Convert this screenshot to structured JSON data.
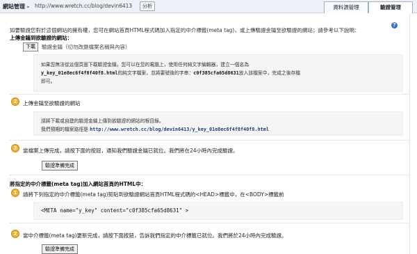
{
  "header": {
    "title": "網站管理",
    "separator": " - ",
    "url": "http://www.wretch.cc/blog/devin6413",
    "analyze_label": "分析",
    "tabs": [
      {
        "label": "資料源管理"
      },
      {
        "label": "驗證管理"
      }
    ]
  },
  "intro": "如要驗證您對於這個網站的擁有權，您可在網站首頁HTML程式碼加入指定的中介標籤(meta tag)，或上傳驗證金鑰至欲驗證的網站；請參考以下說明：",
  "section1": {
    "heading": "上傳金鑰到欲驗證的網站：",
    "download_label": "下載",
    "download_desc": "驗證金鑰（切勿改變檔案名稱與內容）",
    "box_line1": "如果您無法從這個頁面下載驗證金鑰，您可以在您的電腦上，使用任何純文字編輯器，建立一個名為",
    "box_line2_file": "y_key_01e8ec6f4f8f40f8.html",
    "box_line2_mid": "的純文字檔案，並將要號後的字串：",
    "box_line2_key": "c0f385cfa65d8631",
    "box_line2_end": "放入該檔案中，完成之後存檔",
    "box_line3": "即可。",
    "step2_text": "上傳金鑰至欲驗證的網站",
    "box2_line1": "請將下載或自建的驗證金鑰上傳到欲驗證的網站的根目錄。",
    "box2_line2_prefix": "我們預期的檔案路徑是",
    "box2_line2_url": "http://www.wretch.cc/blog/devin6413/y_key_01e8ec6f4f8f40f8.html",
    "step3_text": "當檔案上傳完成，請按下面的按鈕，通知我們驗證金鑰已就位。我們將在24小時內完成驗證。",
    "ready_button": "驗證準備完成"
  },
  "section2": {
    "heading": "將指定的中介標籤(meta tag)加入網站首頁的HTML中：",
    "step1_text": "請將下列指定的中介標籤(meta tag)剪貼到欲驗證網站首頁HTML程式碼的<HEAD>標籤中，在<BODY>標籤前",
    "meta_code": "<META name=\"y_key\" content=\"c0f385cfa65d8631\" >",
    "step2_text": "當中介標籤(meta tag)更新完成，請按下面按鈕，告訴我們指定的中介標籤已就位。我們將於24小時內完成驗證。",
    "ready_button": "驗證準備完成"
  },
  "step_numbers": [
    "1",
    "2",
    "3"
  ],
  "colors": {
    "step_badge": "#f2b232",
    "help_icon": "#3b74c6",
    "topbar": "#eef2f8",
    "codebox": "#f5f5f5"
  }
}
